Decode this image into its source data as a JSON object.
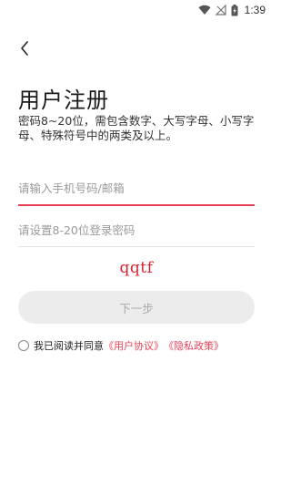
{
  "status_bar": {
    "time": "1:39",
    "icons": [
      "wifi-icon",
      "no-signal-icon",
      "battery-charging-icon"
    ]
  },
  "header": {
    "back_icon": "chevron-left-icon"
  },
  "page": {
    "title": "用户注册",
    "password_hint": "密码8~20位，需包含数字、大写字母、小写字母、特殊符号中的两类及以上。"
  },
  "form": {
    "account_placeholder": "请输入手机号码/邮箱",
    "account_value": "",
    "password_placeholder": "请设置8-20位登录密码",
    "password_value": "",
    "captcha_text": "qqtf",
    "next_label": "下一步"
  },
  "agreement": {
    "checked": false,
    "prefix": "我已阅读并同意",
    "user_agreement_link": "《用户协议》",
    "privacy_policy_link": "《隐私政策》"
  },
  "colors": {
    "accent": "#e8435a",
    "captcha": "#d6232c",
    "button_disabled_bg": "#ececec",
    "button_disabled_text": "#a8a8a8"
  }
}
